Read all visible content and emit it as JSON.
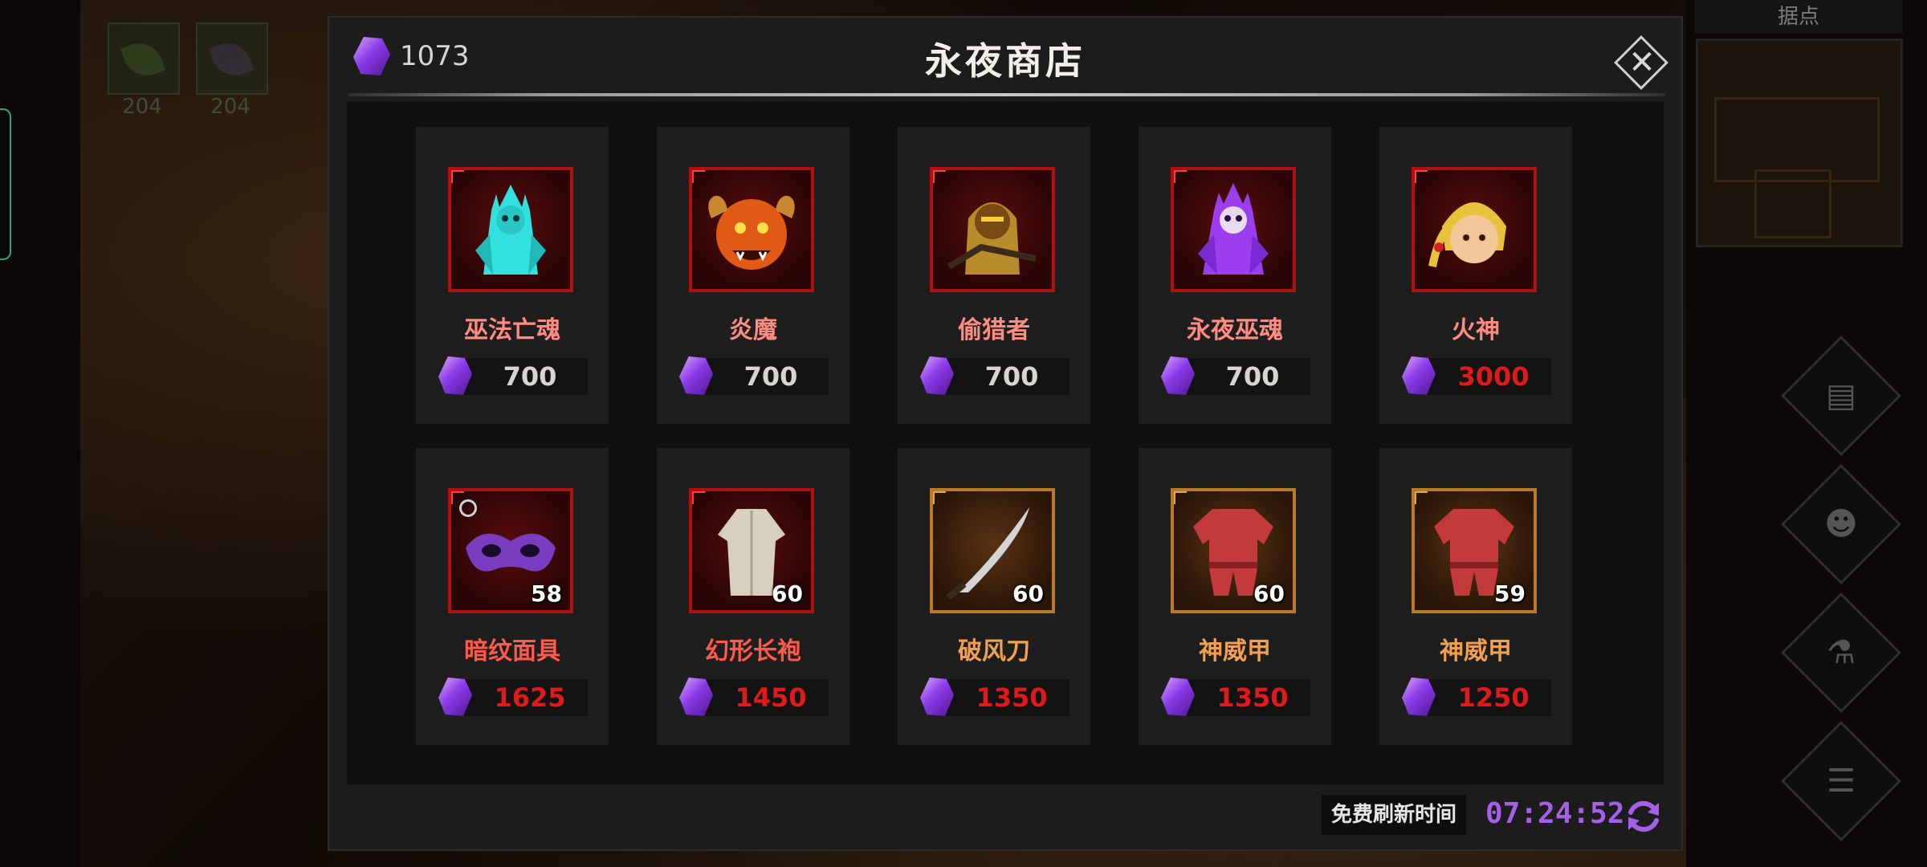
{
  "background": {
    "skill_counts": [
      "204",
      "204"
    ],
    "minimap_title": "据点",
    "side_buttons": [
      {
        "icon": "quest-scroll-icon"
      },
      {
        "icon": "party-icon"
      },
      {
        "icon": "potion-icon"
      },
      {
        "icon": "menu-list-icon"
      }
    ]
  },
  "shop": {
    "title": "永夜商店",
    "currency": {
      "icon": "purple-gem-icon",
      "value": "1073"
    },
    "close_icon": "close-icon",
    "items": [
      {
        "name": "巫法亡魂",
        "price": "700",
        "quantity": "",
        "frame": "red",
        "name_color": "#ff8a80",
        "price_color": "#d8d4cf",
        "icon": "cyan-lich-portrait-icon"
      },
      {
        "name": "炎魔",
        "price": "700",
        "quantity": "",
        "frame": "red",
        "name_color": "#ff8a80",
        "price_color": "#d8d4cf",
        "icon": "fire-demon-portrait-icon"
      },
      {
        "name": "偷猎者",
        "price": "700",
        "quantity": "",
        "frame": "red",
        "name_color": "#ff8a80",
        "price_color": "#d8d4cf",
        "icon": "poacher-portrait-icon"
      },
      {
        "name": "永夜巫魂",
        "price": "700",
        "quantity": "",
        "frame": "red",
        "name_color": "#ff8a80",
        "price_color": "#d8d4cf",
        "icon": "purple-lich-portrait-icon"
      },
      {
        "name": "火神",
        "price": "3000",
        "quantity": "",
        "frame": "red",
        "name_color": "#ff8a80",
        "price_color": "#e0191b",
        "icon": "fire-god-portrait-icon"
      },
      {
        "name": "暗纹面具",
        "price": "1625",
        "quantity": "58",
        "frame": "red",
        "name_color": "#ff5a4a",
        "price_color": "#e0191b",
        "icon": "mask-item-icon"
      },
      {
        "name": "幻形长袍",
        "price": "1450",
        "quantity": "60",
        "frame": "red",
        "name_color": "#ff5a4a",
        "price_color": "#e0191b",
        "icon": "robe-item-icon"
      },
      {
        "name": "破风刀",
        "price": "1350",
        "quantity": "60",
        "frame": "gold",
        "name_color": "#f0a050",
        "price_color": "#e0191b",
        "icon": "blade-item-icon"
      },
      {
        "name": "神威甲",
        "price": "1350",
        "quantity": "60",
        "frame": "gold",
        "name_color": "#f0a050",
        "price_color": "#e0191b",
        "icon": "armor-item-icon"
      },
      {
        "name": "神威甲",
        "price": "1250",
        "quantity": "59",
        "frame": "gold",
        "name_color": "#f0a050",
        "price_color": "#e0191b",
        "icon": "armor-item-icon"
      }
    ],
    "footer": {
      "refresh_label": "免费刷新时间",
      "timer": "07:24:52",
      "refresh_icon": "refresh-icon"
    }
  },
  "colors": {
    "gem": "#8a3be6",
    "timer": "#a65fe8",
    "price_red": "#e0191b"
  }
}
